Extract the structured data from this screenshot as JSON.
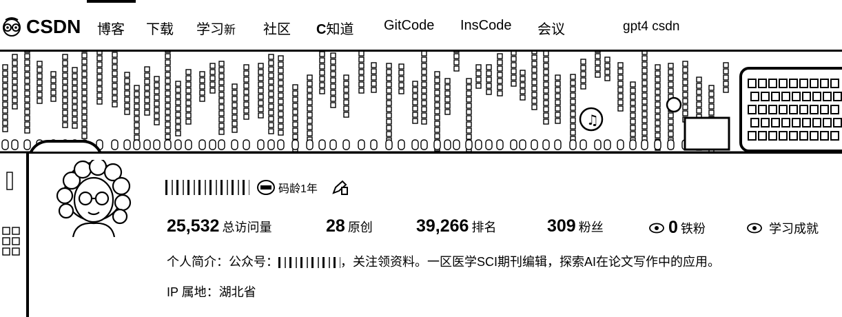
{
  "header": {
    "logo_text": "CSDN",
    "nav": [
      {
        "label": "博客",
        "active": true
      },
      {
        "label": "下载"
      },
      {
        "label": "学习",
        "badge": "新"
      },
      {
        "label": "社区"
      },
      {
        "label": "知道",
        "prefix": "C"
      },
      {
        "label": "GitCode"
      },
      {
        "label": "InsCode"
      },
      {
        "label": "会议"
      }
    ],
    "search_text": "gpt4 csdn"
  },
  "profile": {
    "code_age": "码龄1年",
    "stats": [
      {
        "value": "25,532",
        "label": "总访问量"
      },
      {
        "value": "28",
        "label": "原创"
      },
      {
        "value": "39,266",
        "label": "排名"
      },
      {
        "value": "309",
        "label": "粉丝"
      },
      {
        "value": "0",
        "label": "铁粉",
        "icon": "eye-icon"
      },
      {
        "value": "",
        "label": "学习成就",
        "icon": "eye-icon"
      }
    ],
    "intro_prefix": "个人简介：公众号：",
    "intro_suffix": "，关注领资料。一区医学SCI期刊编辑，探索AI在论文写作中的应用。",
    "ip_label": "IP 属地：",
    "ip_value": "湖北省"
  },
  "colors": {
    "foreground": "#000000",
    "background": "#ffffff"
  }
}
